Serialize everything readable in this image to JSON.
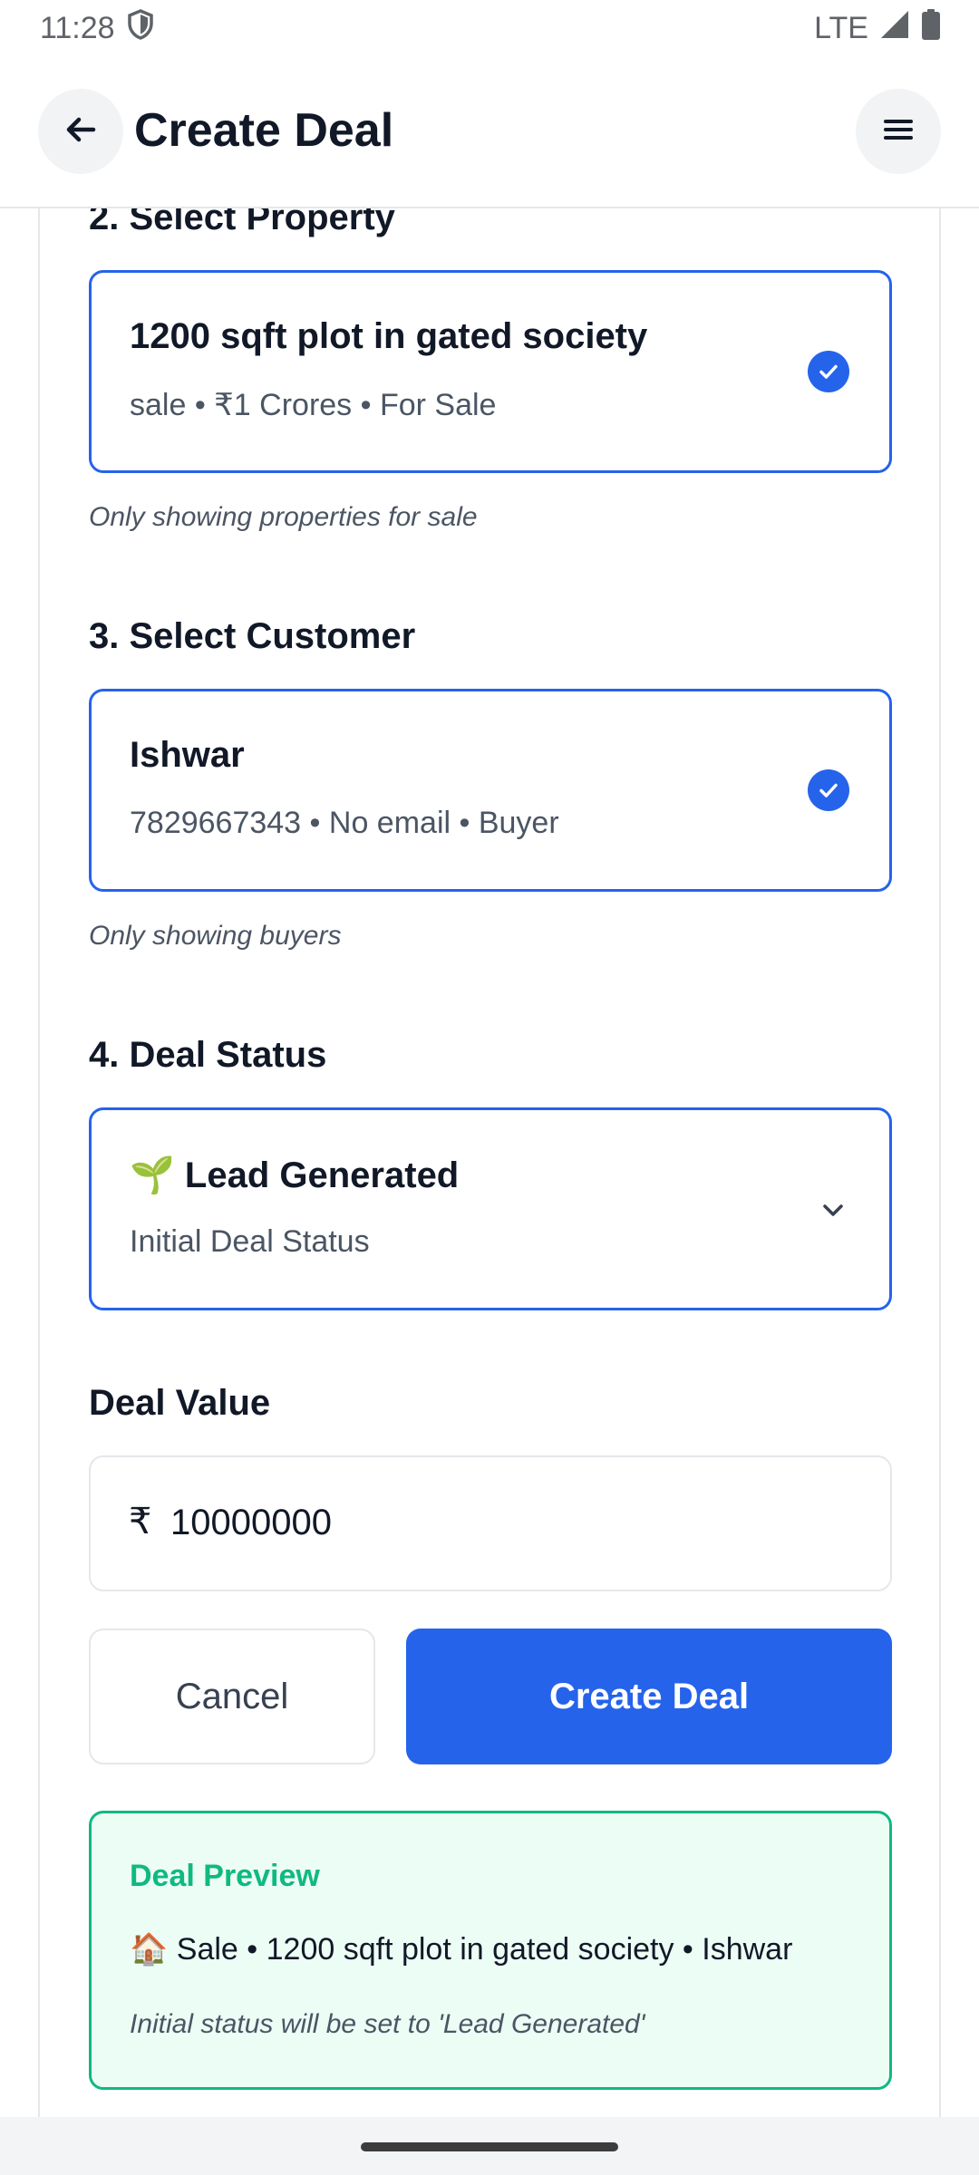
{
  "status_bar": {
    "time": "11:28",
    "network": "LTE",
    "icons": [
      "shield-icon",
      "signal-icon",
      "battery-icon"
    ]
  },
  "app_bar": {
    "title": "Create Deal",
    "back_icon": "arrow-left-icon",
    "menu_icon": "hamburger-menu-icon"
  },
  "property_section": {
    "title": "2. Select Property",
    "card": {
      "title": "1200 sqft plot in gated society",
      "subtitle": "sale • ₹1 Crores • For Sale",
      "selected": true
    },
    "hint": "Only showing properties for sale"
  },
  "customer_section": {
    "title": "3. Select Customer",
    "card": {
      "title": "Ishwar",
      "subtitle": "7829667343 • No email • Buyer",
      "selected": true
    },
    "hint": "Only showing buyers"
  },
  "status_section": {
    "title": "4. Deal Status",
    "dropdown": {
      "selected": "🌱 Lead Generated",
      "subtitle": "Initial Deal Status"
    }
  },
  "value_section": {
    "title": "Deal Value",
    "currency_symbol": "₹",
    "value": "10000000"
  },
  "actions": {
    "cancel_label": "Cancel",
    "create_label": "Create Deal"
  },
  "preview": {
    "title": "Deal Preview",
    "summary": "🏠 Sale • 1200 sqft plot in gated society • Ishwar",
    "note": "Initial status will be set to 'Lead Generated'"
  },
  "colors": {
    "accent": "#2563eb",
    "success": "#10b981",
    "success_bg": "#ecfdf5",
    "text": "#111827",
    "muted": "#4b5563",
    "border": "#e5e7eb"
  }
}
